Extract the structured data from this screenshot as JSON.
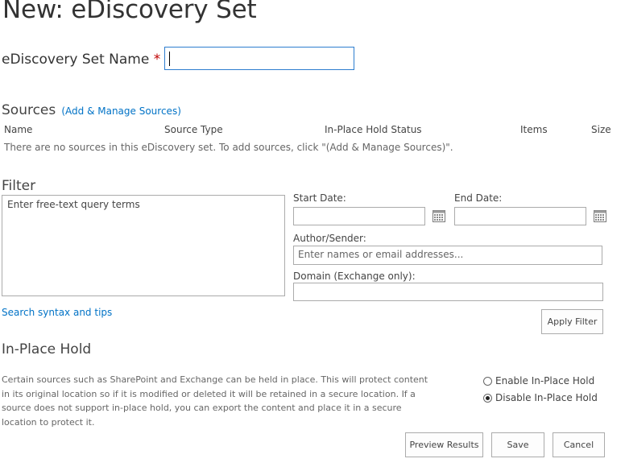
{
  "page": {
    "title": "New: eDiscovery Set"
  },
  "set_name": {
    "label": "eDiscovery Set Name",
    "required_marker": "*",
    "value": ""
  },
  "sources": {
    "title": "Sources",
    "add_link": "(Add & Manage Sources)",
    "columns": [
      "Name",
      "Source Type",
      "In-Place Hold Status",
      "Items",
      "Size"
    ],
    "empty_message": "There are no sources in this eDiscovery set. To add sources, click \"(Add & Manage Sources)\"."
  },
  "filter": {
    "title": "Filter",
    "query_placeholder": "Enter free-text query terms",
    "start_date_label": "Start Date:",
    "end_date_label": "End Date:",
    "start_date_value": "",
    "end_date_value": "",
    "author_label": "Author/Sender:",
    "author_placeholder": "Enter names or email addresses...",
    "domain_label": "Domain (Exchange only):",
    "domain_value": "",
    "search_tips_link": "Search syntax and tips",
    "apply_button": "Apply Filter"
  },
  "hold": {
    "title": "In-Place Hold",
    "description": "Certain sources such as SharePoint and Exchange can be held in place. This will protect content in its original location so if it is modified or deleted it will be retained in a secure location. If a source does not support in-place hold, you can export the content and place it in a secure location to protect it.",
    "enable_label": "Enable In-Place Hold",
    "disable_label": "Disable In-Place Hold",
    "selected": "disable"
  },
  "footer": {
    "preview_button": "Preview Results",
    "save_button": "Save",
    "cancel_button": "Cancel"
  },
  "icons": {
    "calendar": "calendar-icon"
  },
  "colors": {
    "link": "#0072c6",
    "required": "#bf0000",
    "focus_border": "#2d7dcf"
  }
}
